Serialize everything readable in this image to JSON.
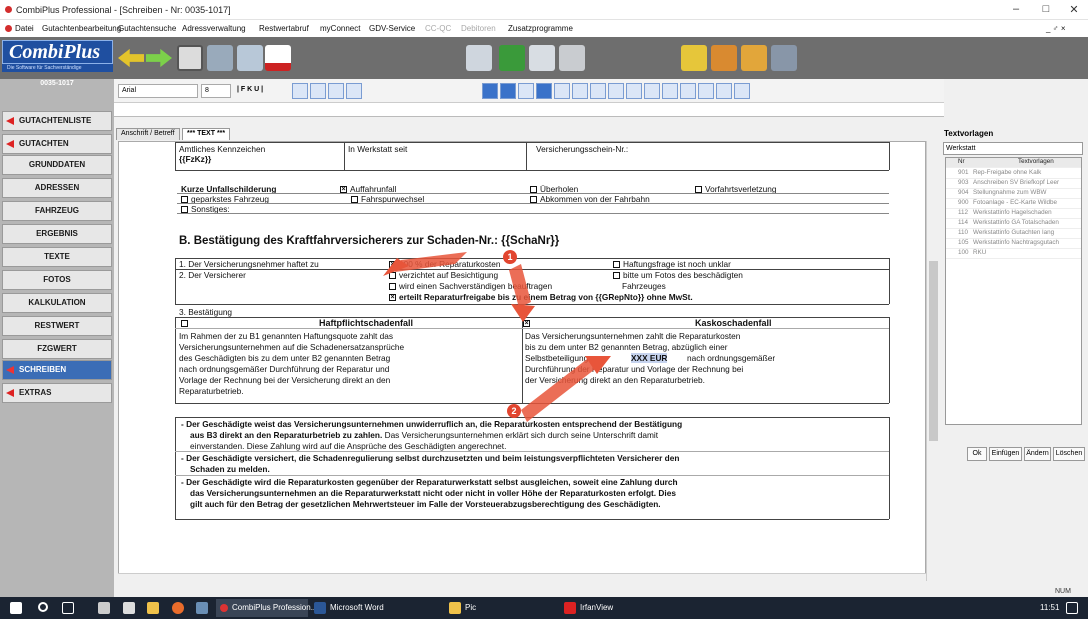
{
  "window": {
    "title": "CombiPlus Professional - [Schreiben - Nr: 0035-1017]",
    "minimize": "–",
    "restore": "□",
    "close": "✕"
  },
  "menu": {
    "items": [
      "Datei",
      "Gutachtenbearbeitung",
      "Gutachtensuche",
      "Adressverwaltung",
      "Restwertabruf",
      "myConnect",
      "GDV-Service",
      "CC-QC",
      "Debitoren",
      "Zusatzprogramme"
    ],
    "right": "_ ♂ ×"
  },
  "logo": {
    "text": "CombiPlus",
    "subtitle": "Die Software für Sachverständige"
  },
  "sidebar": {
    "doc_number": "0035-1017",
    "items": [
      "GUTACHTENLISTE",
      "GUTACHTEN",
      "GRUNDDATEN",
      "ADRESSEN",
      "FAHRZEUG",
      "ERGEBNIS",
      "TEXTE",
      "FOTOS",
      "KALKULATION",
      "RESTWERT",
      "FZGWERT",
      "SCHREIBEN",
      "EXTRAS"
    ]
  },
  "format": {
    "font": "Arial",
    "size": "8",
    "styles": "| F K U |"
  },
  "tabs": [
    "Anschrift / Betreff",
    "*** TEXT ***"
  ],
  "doc": {
    "r1": {
      "kennzeichen_label": "Amtliches Kennzeichen",
      "kennzeichen_value": "{{FzKz}}",
      "werkstatt": "In Werkstatt seit",
      "versicherung": "Versicherungsschein-Nr.:"
    },
    "unfall": {
      "heading": "Kurze Unfallschilderung",
      "opts": [
        "Auffahrunfall",
        "Überholen",
        "Vorfahrtsverletzung",
        "geparkstes Fahrzeug",
        "Fahrspurwechsel",
        "Abkommen von der Fahrbahn",
        "Sonstiges:"
      ]
    },
    "section_b": "B. Bestätigung des Kraftfahrversicherers zur Schaden-Nr.: {{SchaNr}}",
    "b1": "1. Der Versicherungsnehmer haftet zu",
    "b1_opt": "100 % der Reparaturkosten",
    "b1_opt2": "Haftungsfrage ist noch unklar",
    "b2": "2. Der Versicherer",
    "b2_opts": [
      "verzichtet auf Besichtigung",
      "wird einen Sachverständigen beauftragen",
      "erteilt Reparaturfreigabe bis zu einem Betrag von {{GRepNto}} ohne MwSt."
    ],
    "b2_opt2": "bitte um Fotos des beschädigten",
    "b2_opt2b": "Fahrzeuges",
    "b3": "3. Bestätigung",
    "haft_title": "Haftpflichtschadenfall",
    "kasko_title": "Kaskoschadenfall",
    "haft_text": [
      "Im Rahmen der zu B1 genannten Haftungsquote zahlt das",
      "Versicherungsunternehmen auf die Schadenersatzansprüche",
      "des Geschädigten bis zu dem unter B2 genannten Betrag",
      "nach ordnungsgemäßer Durchführung der Reparatur und",
      "Vorlage der Rechnung bei der Versicherung direkt an den",
      "Reparaturbetrieb."
    ],
    "kasko_text": [
      "Das Versicherungsunternehmen zahlt die Reparaturkosten",
      "bis zu dem unter B2 genannten Betrag, abzüglich einer",
      "Selbstbeteiligung von",
      "nach ordnungsgemäßer",
      "Durchführung der Reparatur und Vorlage der Rechnung bei",
      "der Versicherung direkt an den Reparaturbetrieb."
    ],
    "kasko_amount": "XXX EUR",
    "bullets": [
      {
        "bold": "Der Geschädigte weist das Versicherungsunternehmen unwiderruflich an, die Reparaturkosten entsprechend der Bestätigung",
        "bold2": "aus B3 direkt an den Reparaturbetrieb zu zahlen.",
        "normal": " Das Versicherungsunternehmen erklärt sich durch seine Unterschrift damit",
        "normal2": "einverstanden. Diese Zahlung wird auf die Ansprüche des Geschädigten angerechnet."
      },
      {
        "bold": "Der Geschädigte versichert, die Schadenregulierung selbst durchzusetzten und beim leistungsverpflichteten Versicherer den",
        "bold2": "Schaden zu melden."
      },
      {
        "bold": "Der Geschädigte wird die Reparaturkosten gegenüber der Reparaturwerkstatt selbst ausgleichen, soweit eine Zahlung durch",
        "bold2": "das Versicherungsunternehmen an die Reparaturwerkstatt nicht oder nicht in voller Höhe der Reparaturkosten erfolgt. Dies",
        "bold3": "gilt auch für den Betrag der gesetzlichen Mehrwertsteuer im Falle der Vorsteuerabzugsberechtigung des Geschädigten."
      }
    ]
  },
  "markers": [
    "1",
    "2"
  ],
  "textvorlagen": {
    "title": "Textvorlagen",
    "filter": "Werkstatt",
    "col_nr": "Nr",
    "col_name": "Textvorlagen",
    "rows": [
      {
        "nr": "901",
        "name": "Rep-Freigabe ohne Kalk"
      },
      {
        "nr": "903",
        "name": "Anschreiben SV Briefkopf Leer"
      },
      {
        "nr": "904",
        "name": "Stellungnahme zum WBW"
      },
      {
        "nr": "900",
        "name": "Fotoanlage - EC-Karte Wildbe"
      },
      {
        "nr": "112",
        "name": "Werkstattinfo Hagelschaden"
      },
      {
        "nr": "114",
        "name": "Werkstattinfo GA Totalschaden"
      },
      {
        "nr": "110",
        "name": "Werkstattinfo Gutachten lang"
      },
      {
        "nr": "105",
        "name": "Werkstattinfo Nachtragsgutach"
      },
      {
        "nr": "100",
        "name": "RKU"
      }
    ],
    "buttons": [
      "Ok",
      "Einfügen",
      "Ändern",
      "Löschen"
    ]
  },
  "status": {
    "num": "NUM"
  },
  "taskbar": {
    "apps": [
      "CombiPlus Profession...",
      "Microsoft Word",
      "Pic",
      "IrfanView"
    ],
    "time": "11:51"
  }
}
